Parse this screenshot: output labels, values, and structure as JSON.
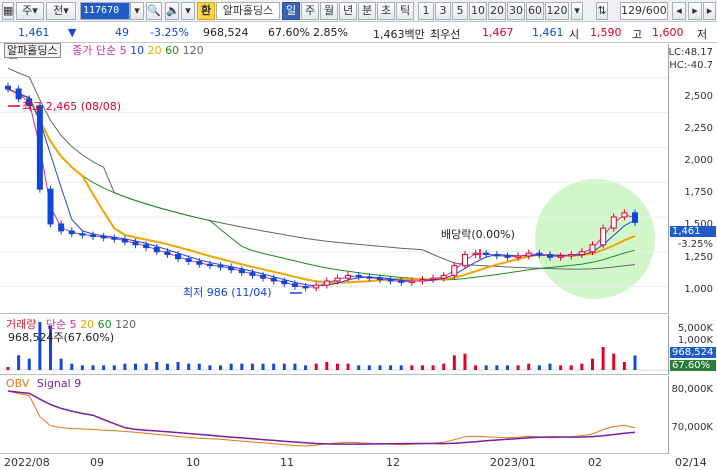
{
  "toolbar": {
    "market": "주",
    "jeon": "전",
    "code": "117670",
    "exchange_label": "환",
    "stock_name": "알파홀딩스",
    "periods": [
      "일",
      "주",
      "월",
      "년",
      "분",
      "초",
      "틱"
    ],
    "active_period": "일",
    "intervals": [
      "1",
      "3",
      "5",
      "10",
      "20",
      "30",
      "60",
      "120"
    ],
    "count": "129",
    "count_total": "/600"
  },
  "quote": {
    "price": "1,461",
    "change": "49",
    "change_pct": "-3.25%",
    "volume": "968,524",
    "vol_ratio": "67.60%",
    "turnover": "2.85%",
    "amount": "1,463백만",
    "best_label": "최우선",
    "ask": "1,467",
    "bid": "1,461",
    "open_label": "시",
    "open": "1,590",
    "high_label": "고",
    "high": "1,600",
    "low_label": "저"
  },
  "price_panel": {
    "stock_tag": "알파홀딩스",
    "ma_label": "종가 단순",
    "ma_periods": [
      "5",
      "10",
      "20",
      "60",
      "120"
    ],
    "ma_colors": [
      "#cc2ea8",
      "#2244dd",
      "#f0a500",
      "#1a8f1a",
      "#666666"
    ],
    "lc": "LC:48.17",
    "hc": "HC:-40.7",
    "y_ticks": [
      "2,500",
      "2,250",
      "2,000",
      "1,750",
      "1,500",
      "1,250",
      "1,000"
    ],
    "last_price_tag": "1,461",
    "last_change_tag": "-3.25%",
    "high_annotation": "최고 2,465 (08/08)",
    "low_annotation": "최저 986 (11/04)",
    "dividend_annotation": "배당락(0.00%)"
  },
  "volume_panel": {
    "label": "거래량",
    "ma_label": "단순",
    "ma_periods": [
      "5",
      "20",
      "60",
      "120"
    ],
    "value_line": "968,524주(67.60%)",
    "y_ticks": [
      "5,000K",
      "1,000K"
    ],
    "last_vol_tag": "968,524",
    "last_pct_tag": "67.60%"
  },
  "obv_panel": {
    "label": "OBV",
    "signal_label": "Signal 9",
    "y_ticks": [
      "80,000K",
      "70,000K"
    ]
  },
  "x_axis": [
    "2022/08",
    "09",
    "10",
    "11",
    "12",
    "2023/01",
    "02",
    "02/14"
  ],
  "chart_data": {
    "type": "line",
    "ylim": [
      860,
      2600
    ],
    "close_approx": [
      2420,
      2350,
      2300,
      1700,
      1450,
      1400,
      1380,
      1370,
      1360,
      1350,
      1340,
      1320,
      1300,
      1280,
      1250,
      1230,
      1200,
      1180,
      1160,
      1150,
      1140,
      1120,
      1100,
      1080,
      1060,
      1040,
      1020,
      1000,
      990,
      1010,
      1040,
      1060,
      1080,
      1070,
      1060,
      1050,
      1040,
      1030,
      1040,
      1050,
      1060,
      1080,
      1150,
      1230,
      1240,
      1230,
      1220,
      1210,
      1220,
      1240,
      1230,
      1210,
      1220,
      1230,
      1250,
      1300,
      1420,
      1500,
      1530,
      1461
    ]
  }
}
